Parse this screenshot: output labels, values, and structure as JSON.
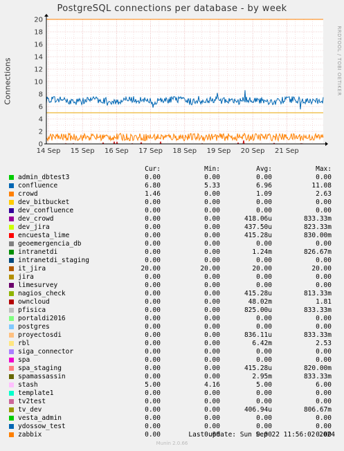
{
  "chart_data": {
    "type": "line",
    "title": "PostgreSQL connections per database - by week",
    "ylabel": "Connections",
    "ylim": [
      0,
      20
    ],
    "yticks": [
      0,
      2,
      4,
      6,
      8,
      10,
      12,
      14,
      16,
      18,
      20
    ],
    "xticks": [
      "14 Sep",
      "15 Sep",
      "16 Sep",
      "17 Sep",
      "18 Sep",
      "19 Sep",
      "20 Sep",
      "21 Sep"
    ],
    "grid": true,
    "plotted_series": [
      {
        "name": "it_jira",
        "color": "#ff7f00",
        "constant": 20.0
      },
      {
        "name": "stash",
        "color": "#e8a400",
        "constant": 5.0
      },
      {
        "name": "confluence",
        "color": "#0066b3",
        "min": 5.33,
        "avg": 6.96,
        "max": 11.08
      },
      {
        "name": "crowd",
        "color": "#ff8000",
        "min": 0.0,
        "avg": 1.09,
        "max": 2.63
      },
      {
        "name": "owncloud",
        "color": "#cc0000",
        "min": 0.0,
        "avg": 0.05,
        "max": 1.81
      }
    ]
  },
  "legend": {
    "headers": {
      "cur": "Cur:",
      "min": "Min:",
      "avg": "Avg:",
      "max": "Max:"
    },
    "rows": [
      {
        "name": "admin_dbtest3",
        "color": "#00cc00",
        "cur": "0.00",
        "min": "0.00",
        "avg": "0.00",
        "max": "0.00"
      },
      {
        "name": "confluence",
        "color": "#0066b3",
        "cur": "6.80",
        "min": "5.33",
        "avg": "6.96",
        "max": "11.08"
      },
      {
        "name": "crowd",
        "color": "#ff8000",
        "cur": "1.46",
        "min": "0.00",
        "avg": "1.09",
        "max": "2.63"
      },
      {
        "name": "dev_bitbucket",
        "color": "#ffcc00",
        "cur": "0.00",
        "min": "0.00",
        "avg": "0.00",
        "max": "0.00"
      },
      {
        "name": "dev_confluence",
        "color": "#330099",
        "cur": "0.00",
        "min": "0.00",
        "avg": "0.00",
        "max": "0.00"
      },
      {
        "name": "dev_crowd",
        "color": "#990099",
        "cur": "0.00",
        "min": "0.00",
        "avg": "418.06u",
        "max": "833.33m"
      },
      {
        "name": "dev_jira",
        "color": "#ccff00",
        "cur": "0.00",
        "min": "0.00",
        "avg": "437.50u",
        "max": "823.33m"
      },
      {
        "name": "encuesta_lime",
        "color": "#ff0000",
        "cur": "0.00",
        "min": "0.00",
        "avg": "415.28u",
        "max": "830.00m"
      },
      {
        "name": "geoemergencia_db",
        "color": "#808080",
        "cur": "0.00",
        "min": "0.00",
        "avg": "0.00",
        "max": "0.00"
      },
      {
        "name": "intranetdi",
        "color": "#008f00",
        "cur": "0.00",
        "min": "0.00",
        "avg": "1.24m",
        "max": "826.67m"
      },
      {
        "name": "intranetdi_staging",
        "color": "#00487d",
        "cur": "0.00",
        "min": "0.00",
        "avg": "0.00",
        "max": "0.00"
      },
      {
        "name": "it_jira",
        "color": "#b35a00",
        "cur": "20.00",
        "min": "20.00",
        "avg": "20.00",
        "max": "20.00"
      },
      {
        "name": "jira",
        "color": "#b38f00",
        "cur": "0.00",
        "min": "0.00",
        "avg": "0.00",
        "max": "0.00"
      },
      {
        "name": "limesurvey",
        "color": "#6b006b",
        "cur": "0.00",
        "min": "0.00",
        "avg": "0.00",
        "max": "0.00"
      },
      {
        "name": "nagios_check",
        "color": "#8fb300",
        "cur": "0.00",
        "min": "0.00",
        "avg": "415.28u",
        "max": "813.33m"
      },
      {
        "name": "owncloud",
        "color": "#b30000",
        "cur": "0.00",
        "min": "0.00",
        "avg": "48.02m",
        "max": "1.81"
      },
      {
        "name": "pfisica",
        "color": "#bebebe",
        "cur": "0.00",
        "min": "0.00",
        "avg": "825.00u",
        "max": "833.33m"
      },
      {
        "name": "portaldi2016",
        "color": "#80ff80",
        "cur": "0.00",
        "min": "0.00",
        "avg": "0.00",
        "max": "0.00"
      },
      {
        "name": "postgres",
        "color": "#80c9ff",
        "cur": "0.00",
        "min": "0.00",
        "avg": "0.00",
        "max": "0.00"
      },
      {
        "name": "proyectosdi",
        "color": "#ffc080",
        "cur": "0.00",
        "min": "0.00",
        "avg": "836.11u",
        "max": "833.33m"
      },
      {
        "name": "rbl",
        "color": "#ffe680",
        "cur": "0.00",
        "min": "0.00",
        "avg": "6.42m",
        "max": "2.53"
      },
      {
        "name": "siga_connector",
        "color": "#aa80ff",
        "cur": "0.00",
        "min": "0.00",
        "avg": "0.00",
        "max": "0.00"
      },
      {
        "name": "spa",
        "color": "#ee00cc",
        "cur": "0.00",
        "min": "0.00",
        "avg": "0.00",
        "max": "0.00"
      },
      {
        "name": "spa_staging",
        "color": "#ff8080",
        "cur": "0.00",
        "min": "0.00",
        "avg": "415.28u",
        "max": "820.00m"
      },
      {
        "name": "spamassassin",
        "color": "#666600",
        "cur": "0.00",
        "min": "0.00",
        "avg": "2.95m",
        "max": "833.33m"
      },
      {
        "name": "stash",
        "color": "#ffbfff",
        "cur": "5.00",
        "min": "4.16",
        "avg": "5.00",
        "max": "6.00"
      },
      {
        "name": "template1",
        "color": "#00ffcc",
        "cur": "0.00",
        "min": "0.00",
        "avg": "0.00",
        "max": "0.00"
      },
      {
        "name": "tv2test",
        "color": "#cc6699",
        "cur": "0.00",
        "min": "0.00",
        "avg": "0.00",
        "max": "0.00"
      },
      {
        "name": "tv_dev",
        "color": "#999900",
        "cur": "0.00",
        "min": "0.00",
        "avg": "406.94u",
        "max": "806.67m"
      },
      {
        "name": "vesta_admin",
        "color": "#00cc00",
        "cur": "0.00",
        "min": "0.00",
        "avg": "0.00",
        "max": "0.00"
      },
      {
        "name": "ydossow_test",
        "color": "#0066b3",
        "cur": "0.00",
        "min": "0.00",
        "avg": "0.00",
        "max": "0.00"
      },
      {
        "name": "zabbix",
        "color": "#ff8000",
        "cur": "0.00",
        "min": "0.00",
        "avg": "0.00",
        "max": "0.00"
      }
    ]
  },
  "last_update": "Last update: Sun Sep 22 11:56:02 2024",
  "watermark": "RRDTOOL / TOBI OETIKER",
  "footer": "Munin 2.0.66"
}
